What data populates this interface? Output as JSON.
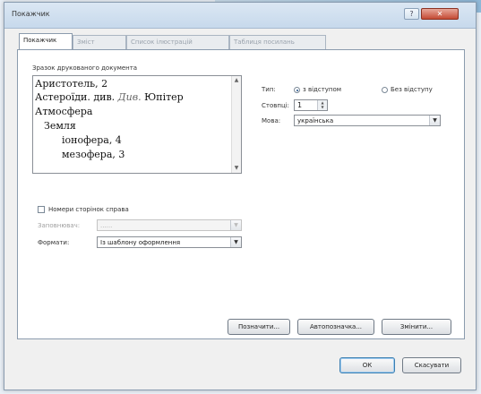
{
  "window": {
    "title": "Покажчик"
  },
  "tabs": [
    "Покажчик",
    "Зміст",
    "Список ілюстрацій",
    "Таблиця посилань"
  ],
  "preview": {
    "label": "Зразок друкованого документа",
    "lines": [
      {
        "text": "Аристотель, 2",
        "page": ""
      },
      {
        "text": "Астероїди. див.",
        "page": "Див.",
        "tail": "Юпітер"
      },
      {
        "text": "Атмосфера",
        "page": ""
      },
      {
        "text": "Земля",
        "page": ""
      },
      {
        "text": "іонофера, 4",
        "page": ""
      },
      {
        "text": "мезофера, 3",
        "page": ""
      }
    ]
  },
  "type": {
    "label": "Тип:",
    "option_indent": "з відступом",
    "option_run_in": "Без відступу",
    "selected": "з відступом"
  },
  "columns": {
    "label": "Стовпці:",
    "value": "1"
  },
  "language": {
    "label": "Мова:",
    "value": "українська"
  },
  "right_align": {
    "label": "Номери сторінок справа",
    "checked": false
  },
  "tab_leader": {
    "label": "Заповнювач:",
    "value": "......"
  },
  "formats": {
    "label": "Формати:",
    "value": "Із шаблону оформлення"
  },
  "buttons": {
    "mark_entry": "Позначити...",
    "automark": "Автопозначка...",
    "modify": "Змінити...",
    "ok": "ОК",
    "cancel": "Скасувати"
  },
  "icons": {
    "close": "close-icon",
    "help": "help-icon",
    "dropdown": "chevron-down-icon",
    "spinner": "spinner-arrows-icon"
  }
}
